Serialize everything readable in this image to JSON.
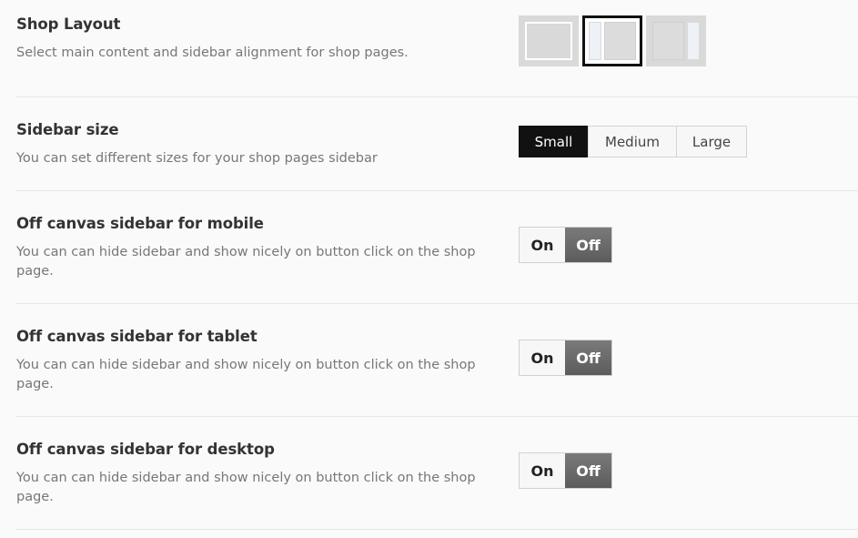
{
  "shop_layout": {
    "title": "Shop Layout",
    "description": "Select main content and sidebar alignment for shop pages.",
    "options": [
      {
        "name": "full-width",
        "selected": false
      },
      {
        "name": "sidebar-left",
        "selected": true
      },
      {
        "name": "sidebar-right",
        "selected": false
      }
    ]
  },
  "sidebar_size": {
    "title": "Sidebar size",
    "description": "You can set different sizes for your shop pages sidebar",
    "options": [
      "Small",
      "Medium",
      "Large"
    ],
    "selected": "Small"
  },
  "offcanvas_mobile": {
    "title": "Off canvas sidebar for mobile",
    "description": "You can can hide sidebar and show nicely on button click on the shop page.",
    "on_label": "On",
    "off_label": "Off",
    "state": "Off"
  },
  "offcanvas_tablet": {
    "title": "Off canvas sidebar for tablet",
    "description": "You can can hide sidebar and show nicely on button click on the shop page.",
    "on_label": "On",
    "off_label": "Off",
    "state": "Off"
  },
  "offcanvas_desktop": {
    "title": "Off canvas sidebar for desktop",
    "description": "You can can hide sidebar and show nicely on button click on the shop page.",
    "on_label": "On",
    "off_label": "Off",
    "state": "Off"
  },
  "colors": {
    "accent": "#111111",
    "toggle_off": "#666666",
    "divider": "#e6e6e6"
  }
}
